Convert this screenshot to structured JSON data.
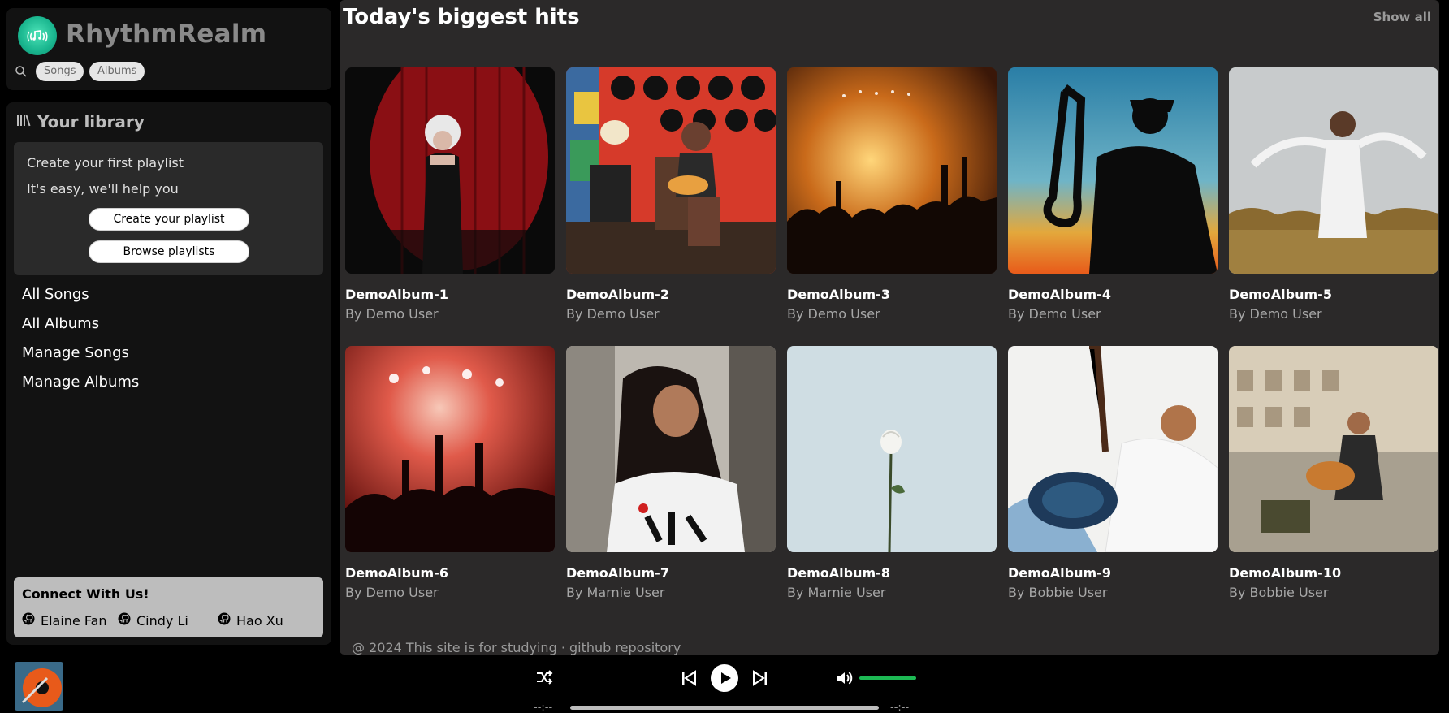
{
  "app": {
    "name": "RhythmRealm",
    "search_tags": [
      "Songs",
      "Albums"
    ]
  },
  "library": {
    "title": "Your library",
    "create_title": "Create your first playlist",
    "create_sub": "It's easy, we'll help you",
    "create_button": "Create your playlist",
    "browse_button": "Browse playlists",
    "nav": [
      "All Songs",
      "All Albums",
      "Manage Songs",
      "Manage Albums"
    ],
    "connect_title": "Connect With Us!",
    "contributors": [
      "Elaine Fan",
      "Cindy Li",
      "Hao Xu"
    ]
  },
  "main": {
    "title": "Today's biggest hits",
    "show_all": "Show all",
    "albums": [
      {
        "name": "DemoAlbum-1",
        "artist": "By Demo User",
        "scene": "red-curtain-singer"
      },
      {
        "name": "DemoAlbum-2",
        "artist": "By Demo User",
        "scene": "vinyl-wall-guitarist"
      },
      {
        "name": "DemoAlbum-3",
        "artist": "By Demo User",
        "scene": "concert-crowd-golden"
      },
      {
        "name": "DemoAlbum-4",
        "artist": "By Demo User",
        "scene": "saxophone-silhouette-sunset"
      },
      {
        "name": "DemoAlbum-5",
        "artist": "By Demo User",
        "scene": "dancer-field"
      },
      {
        "name": "DemoAlbum-6",
        "artist": "By Demo User",
        "scene": "red-concert-crowd"
      },
      {
        "name": "DemoAlbum-7",
        "artist": "By Marnie User",
        "scene": "woman-earbuds"
      },
      {
        "name": "DemoAlbum-8",
        "artist": "By Marnie User",
        "scene": "white-rose"
      },
      {
        "name": "DemoAlbum-9",
        "artist": "By Bobbie User",
        "scene": "woman-electric-guitar"
      },
      {
        "name": "DemoAlbum-10",
        "artist": "By Bobbie User",
        "scene": "street-guitarist"
      }
    ],
    "footer": "@ 2024 This site is for studying · github repository"
  },
  "player": {
    "time_current": "--:--",
    "time_total": "--:--",
    "volume": 1.0,
    "progress": 0,
    "icons": [
      "shuffle-icon",
      "previous-icon",
      "play-icon",
      "next-icon",
      "volume-icon"
    ]
  },
  "colors": {
    "accent": "#1db954",
    "main_bg": "#2b2929",
    "panel_bg": "#121212",
    "logo": "#19b58e"
  }
}
